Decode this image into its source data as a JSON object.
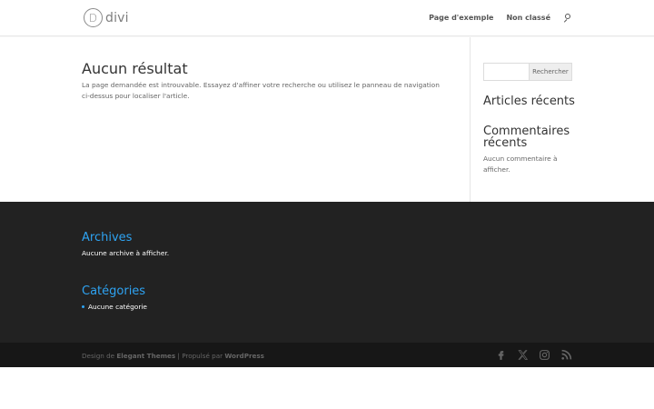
{
  "header": {
    "logo_letter": "D",
    "logo_text": "divi",
    "nav": [
      {
        "label": "Page d'exemple"
      },
      {
        "label": "Non classé"
      }
    ],
    "search_icon": "search-icon"
  },
  "main": {
    "title": "Aucun résultat",
    "text": "La page demandée est introuvable. Essayez d'affiner votre recherche ou utilisez le panneau de navigation ci-dessus pour localiser l'article."
  },
  "sidebar": {
    "search_placeholder": "",
    "search_button": "Rechercher",
    "recent_articles_title": "Articles récents",
    "recent_comments_title": "Commentaires récents",
    "no_comments_text": "Aucun commentaire à afficher."
  },
  "footer": {
    "archives_title": "Archives",
    "archives_text": "Aucune archive à afficher.",
    "categories_title": "Catégories",
    "categories_item": "Aucune catégorie",
    "accent_color": "#2ea3f2"
  },
  "bottom": {
    "credit_prefix": "Design de ",
    "credit_theme": "Elegant Themes",
    "credit_middle": " | Propulsé par ",
    "credit_platform": "WordPress",
    "socials": [
      "facebook-icon",
      "x-icon",
      "instagram-icon",
      "rss-icon"
    ]
  }
}
